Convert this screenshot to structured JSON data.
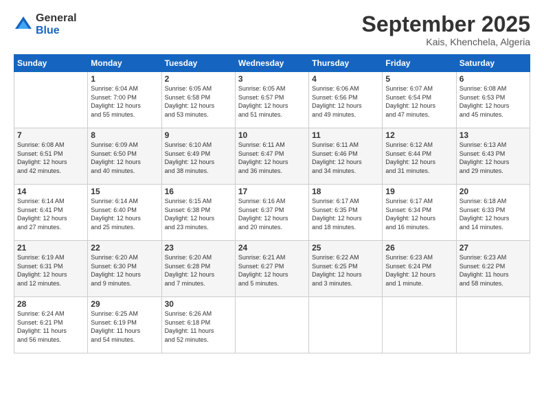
{
  "header": {
    "logo_general": "General",
    "logo_blue": "Blue",
    "month_title": "September 2025",
    "location": "Kais, Khenchela, Algeria"
  },
  "calendar": {
    "weekdays": [
      "Sunday",
      "Monday",
      "Tuesday",
      "Wednesday",
      "Thursday",
      "Friday",
      "Saturday"
    ],
    "rows": [
      [
        {
          "day": "",
          "info": ""
        },
        {
          "day": "1",
          "info": "Sunrise: 6:04 AM\nSunset: 7:00 PM\nDaylight: 12 hours\nand 55 minutes."
        },
        {
          "day": "2",
          "info": "Sunrise: 6:05 AM\nSunset: 6:58 PM\nDaylight: 12 hours\nand 53 minutes."
        },
        {
          "day": "3",
          "info": "Sunrise: 6:05 AM\nSunset: 6:57 PM\nDaylight: 12 hours\nand 51 minutes."
        },
        {
          "day": "4",
          "info": "Sunrise: 6:06 AM\nSunset: 6:56 PM\nDaylight: 12 hours\nand 49 minutes."
        },
        {
          "day": "5",
          "info": "Sunrise: 6:07 AM\nSunset: 6:54 PM\nDaylight: 12 hours\nand 47 minutes."
        },
        {
          "day": "6",
          "info": "Sunrise: 6:08 AM\nSunset: 6:53 PM\nDaylight: 12 hours\nand 45 minutes."
        }
      ],
      [
        {
          "day": "7",
          "info": "Sunrise: 6:08 AM\nSunset: 6:51 PM\nDaylight: 12 hours\nand 42 minutes."
        },
        {
          "day": "8",
          "info": "Sunrise: 6:09 AM\nSunset: 6:50 PM\nDaylight: 12 hours\nand 40 minutes."
        },
        {
          "day": "9",
          "info": "Sunrise: 6:10 AM\nSunset: 6:49 PM\nDaylight: 12 hours\nand 38 minutes."
        },
        {
          "day": "10",
          "info": "Sunrise: 6:11 AM\nSunset: 6:47 PM\nDaylight: 12 hours\nand 36 minutes."
        },
        {
          "day": "11",
          "info": "Sunrise: 6:11 AM\nSunset: 6:46 PM\nDaylight: 12 hours\nand 34 minutes."
        },
        {
          "day": "12",
          "info": "Sunrise: 6:12 AM\nSunset: 6:44 PM\nDaylight: 12 hours\nand 31 minutes."
        },
        {
          "day": "13",
          "info": "Sunrise: 6:13 AM\nSunset: 6:43 PM\nDaylight: 12 hours\nand 29 minutes."
        }
      ],
      [
        {
          "day": "14",
          "info": "Sunrise: 6:14 AM\nSunset: 6:41 PM\nDaylight: 12 hours\nand 27 minutes."
        },
        {
          "day": "15",
          "info": "Sunrise: 6:14 AM\nSunset: 6:40 PM\nDaylight: 12 hours\nand 25 minutes."
        },
        {
          "day": "16",
          "info": "Sunrise: 6:15 AM\nSunset: 6:38 PM\nDaylight: 12 hours\nand 23 minutes."
        },
        {
          "day": "17",
          "info": "Sunrise: 6:16 AM\nSunset: 6:37 PM\nDaylight: 12 hours\nand 20 minutes."
        },
        {
          "day": "18",
          "info": "Sunrise: 6:17 AM\nSunset: 6:35 PM\nDaylight: 12 hours\nand 18 minutes."
        },
        {
          "day": "19",
          "info": "Sunrise: 6:17 AM\nSunset: 6:34 PM\nDaylight: 12 hours\nand 16 minutes."
        },
        {
          "day": "20",
          "info": "Sunrise: 6:18 AM\nSunset: 6:33 PM\nDaylight: 12 hours\nand 14 minutes."
        }
      ],
      [
        {
          "day": "21",
          "info": "Sunrise: 6:19 AM\nSunset: 6:31 PM\nDaylight: 12 hours\nand 12 minutes."
        },
        {
          "day": "22",
          "info": "Sunrise: 6:20 AM\nSunset: 6:30 PM\nDaylight: 12 hours\nand 9 minutes."
        },
        {
          "day": "23",
          "info": "Sunrise: 6:20 AM\nSunset: 6:28 PM\nDaylight: 12 hours\nand 7 minutes."
        },
        {
          "day": "24",
          "info": "Sunrise: 6:21 AM\nSunset: 6:27 PM\nDaylight: 12 hours\nand 5 minutes."
        },
        {
          "day": "25",
          "info": "Sunrise: 6:22 AM\nSunset: 6:25 PM\nDaylight: 12 hours\nand 3 minutes."
        },
        {
          "day": "26",
          "info": "Sunrise: 6:23 AM\nSunset: 6:24 PM\nDaylight: 12 hours\nand 1 minute."
        },
        {
          "day": "27",
          "info": "Sunrise: 6:23 AM\nSunset: 6:22 PM\nDaylight: 11 hours\nand 58 minutes."
        }
      ],
      [
        {
          "day": "28",
          "info": "Sunrise: 6:24 AM\nSunset: 6:21 PM\nDaylight: 11 hours\nand 56 minutes."
        },
        {
          "day": "29",
          "info": "Sunrise: 6:25 AM\nSunset: 6:19 PM\nDaylight: 11 hours\nand 54 minutes."
        },
        {
          "day": "30",
          "info": "Sunrise: 6:26 AM\nSunset: 6:18 PM\nDaylight: 11 hours\nand 52 minutes."
        },
        {
          "day": "",
          "info": ""
        },
        {
          "day": "",
          "info": ""
        },
        {
          "day": "",
          "info": ""
        },
        {
          "day": "",
          "info": ""
        }
      ]
    ]
  }
}
